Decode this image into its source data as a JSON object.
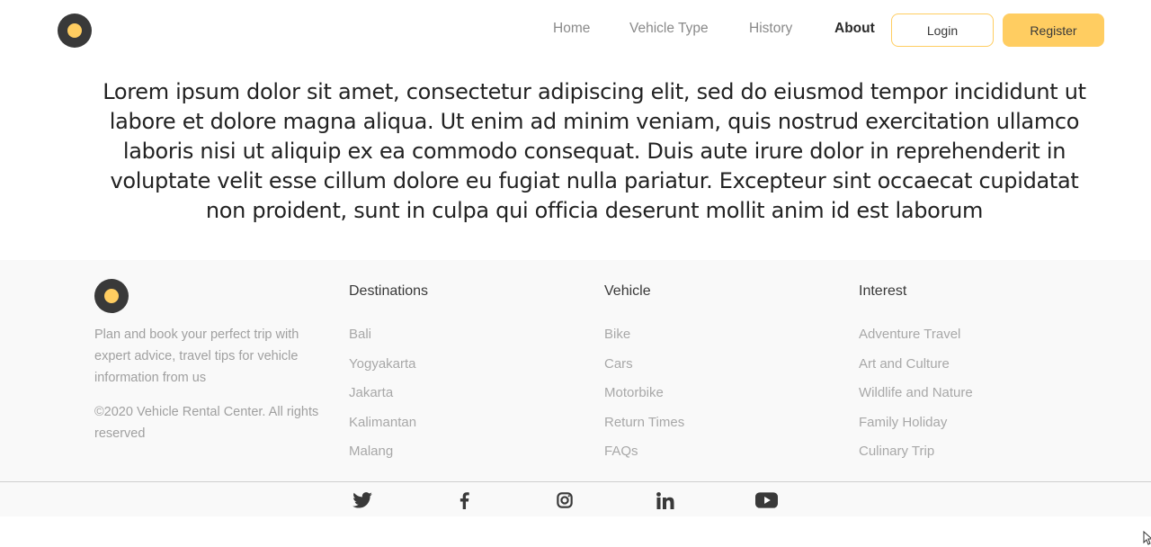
{
  "nav": {
    "items": [
      {
        "label": "Home",
        "active": false
      },
      {
        "label": "Vehicle Type",
        "active": false
      },
      {
        "label": "History",
        "active": false
      },
      {
        "label": "About",
        "active": true
      }
    ],
    "login_label": "Login",
    "register_label": "Register"
  },
  "about": {
    "text": "Lorem ipsum dolor sit amet, consectetur adipiscing elit, sed do eiusmod tempor incididunt ut labore et dolore magna aliqua. Ut enim ad minim veniam, quis nostrud exercitation ullamco laboris nisi ut aliquip ex ea commodo consequat. Duis aute irure dolor in reprehenderit in voluptate velit esse cillum dolore eu fugiat nulla pariatur. Excepteur sint occaecat cupidatat non proident, sunt in culpa qui officia deserunt mollit anim id est laborum"
  },
  "footer": {
    "description": "Plan and book your perfect trip with expert advice, travel tips for vehicle information from us",
    "copyright": "©2020 Vehicle Rental Center. All rights reserved",
    "columns": [
      {
        "title": "Destinations",
        "items": [
          "Bali",
          "Yogyakarta",
          "Jakarta",
          "Kalimantan",
          "Malang"
        ]
      },
      {
        "title": "Vehicle",
        "items": [
          "Bike",
          "Cars",
          "Motorbike",
          "Return Times",
          "FAQs"
        ]
      },
      {
        "title": "Interest",
        "items": [
          "Adventure Travel",
          "Art and Culture",
          "Wildlife and Nature",
          "Family Holiday",
          "Culinary Trip"
        ]
      }
    ],
    "social": [
      "twitter-icon",
      "facebook-icon",
      "instagram-icon",
      "linkedin-icon",
      "youtube-icon"
    ]
  },
  "colors": {
    "accent": "#FFCD61",
    "dark": "#393939",
    "footer_bg": "#F9F9F9",
    "muted_text": "#A0A0A0"
  }
}
